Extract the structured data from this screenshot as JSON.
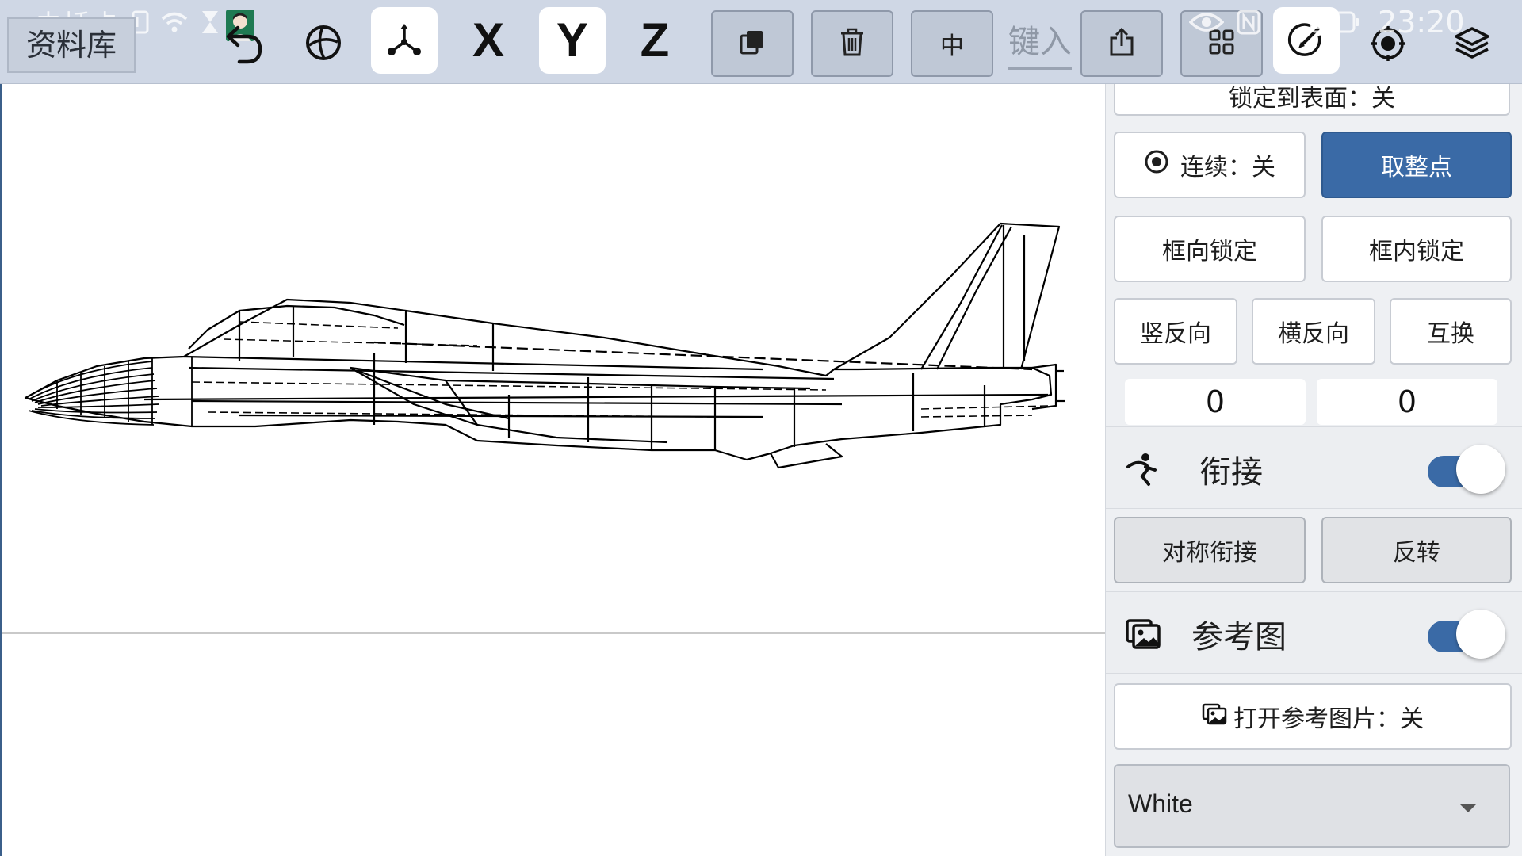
{
  "status_bar": {
    "carrier": "未插卡",
    "time": "23:20"
  },
  "toolbar": {
    "library_label": "资料库",
    "axis_x": "X",
    "axis_y": "Y",
    "axis_z": "Z",
    "center_label": "中",
    "type_input_label": "键入",
    "icons": [
      "undo-icon",
      "globe-icon",
      "axes-icon",
      "copy-icon",
      "trash-icon",
      "export-icon",
      "grid-icon",
      "edit-circle-icon",
      "camera-target-icon",
      "layers-icon"
    ]
  },
  "panel": {
    "lock_to_surface_label": "锁定到表面：关",
    "continuous_label": "连续：关",
    "snap_label": "取整点",
    "frame_dir_lock_label": "框向锁定",
    "frame_inner_lock_label": "框内锁定",
    "vertical_reverse_label": "竖反向",
    "horizontal_reverse_label": "横反向",
    "swap_label": "互换",
    "value_left": "0",
    "value_right": "0",
    "junction_title": "衔接",
    "symmetric_junction_label": "对称衔接",
    "reverse_label": "反转",
    "reference_title": "参考图",
    "open_reference_label": "打开参考图片：关",
    "dropdown_value": "White",
    "toggle_junction_on": true,
    "toggle_reference_on": true
  },
  "colors": {
    "toolbar_bg": "#cfd7e5",
    "accent": "#3a6aa6",
    "panel_bg": "#eef0f3"
  }
}
